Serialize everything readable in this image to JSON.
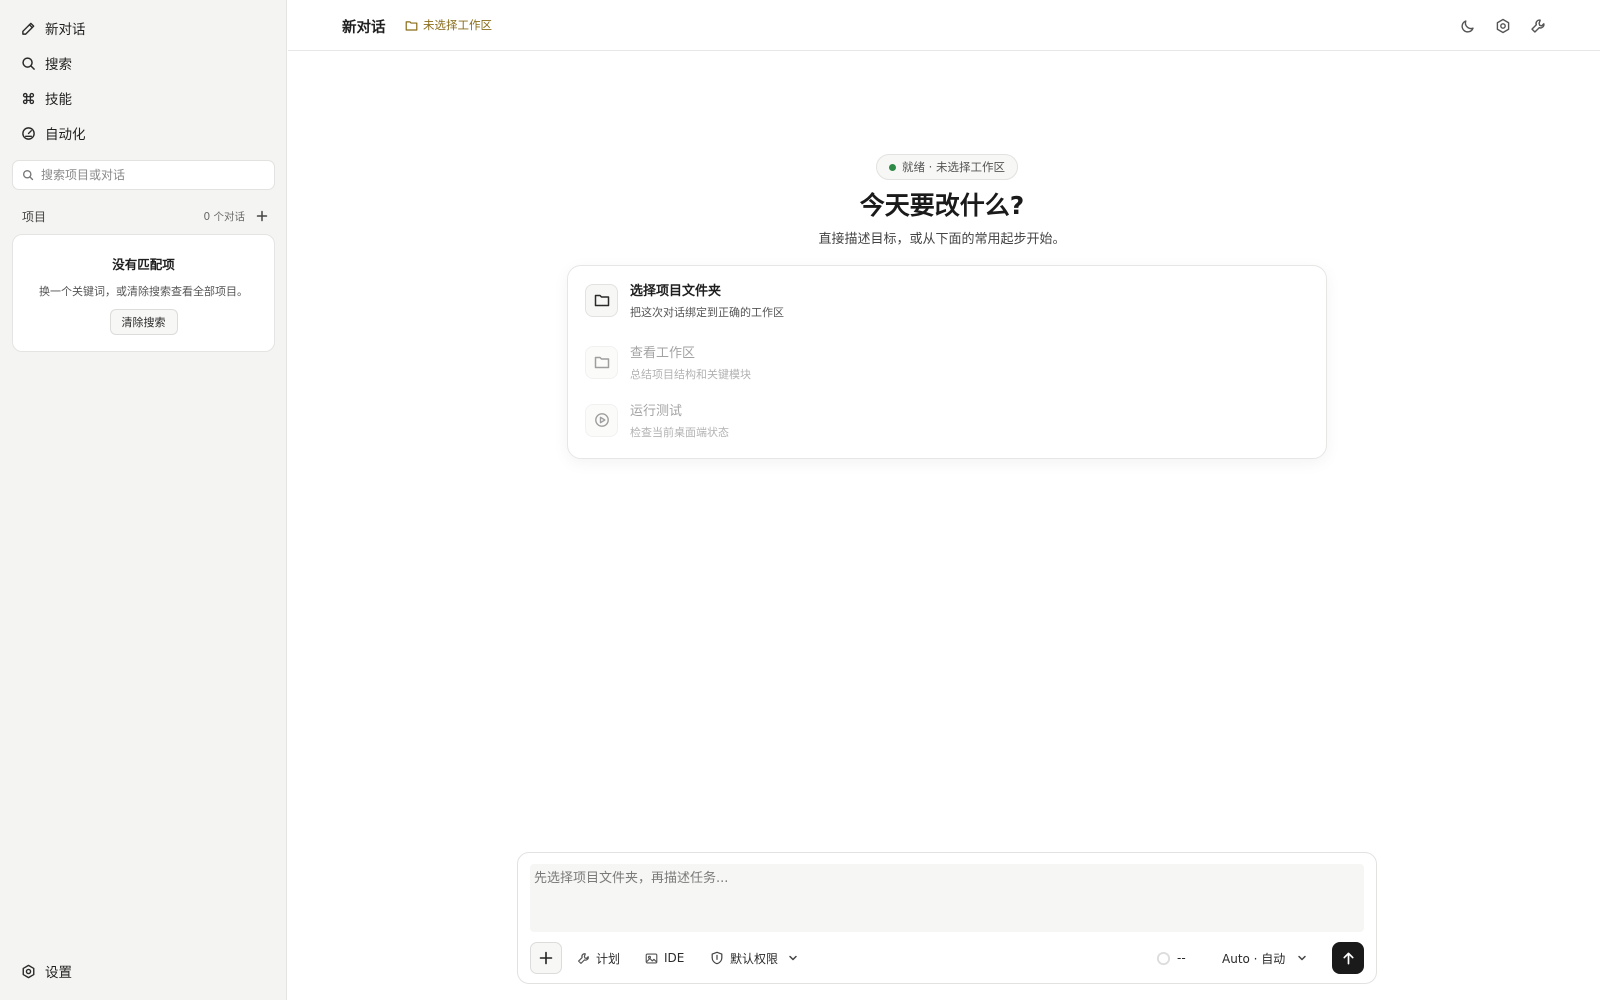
{
  "sidebar": {
    "nav": [
      {
        "label": "新对话",
        "icon": "pencil-icon"
      },
      {
        "label": "搜索",
        "icon": "search-icon"
      },
      {
        "label": "技能",
        "icon": "command-icon"
      },
      {
        "label": "自动化",
        "icon": "gauge-icon"
      }
    ],
    "search_placeholder": "搜索项目或对话",
    "projects_label": "项目",
    "projects_count": "0 个对话",
    "empty": {
      "title": "没有匹配项",
      "desc": "换一个关键词，或清除搜索查看全部项目。",
      "button": "清除搜索"
    },
    "settings_label": "设置"
  },
  "header": {
    "title": "新对话",
    "workspace": "未选择工作区",
    "icons": [
      "moon-icon",
      "settings-gear-icon",
      "wrench-icon"
    ]
  },
  "hero": {
    "status": "就绪 · 未选择工作区",
    "title": "今天要改什么?",
    "subtitle": "直接描述目标，或从下面的常用起步开始。",
    "actions": [
      {
        "title": "选择项目文件夹",
        "desc": "把这次对话绑定到正确的工作区",
        "icon": "folder-icon",
        "enabled": true
      },
      {
        "title": "查看工作区",
        "desc": "总结项目结构和关键模块",
        "icon": "folder-icon",
        "enabled": false
      },
      {
        "title": "运行测试",
        "desc": "检查当前桌面端状态",
        "icon": "play-circle-icon",
        "enabled": false
      }
    ]
  },
  "composer": {
    "placeholder": "先选择项目文件夹，再描述任务...",
    "plan_label": "计划",
    "ide_label": "IDE",
    "permission_label": "默认权限",
    "context_label": "--",
    "model_label": "Auto · 自动"
  },
  "colors": {
    "sidebar_bg": "#f4f4f2",
    "workspace_accent": "#8a6d1a",
    "status_green": "#2e8b47",
    "send_button": "#1a1a1a"
  }
}
